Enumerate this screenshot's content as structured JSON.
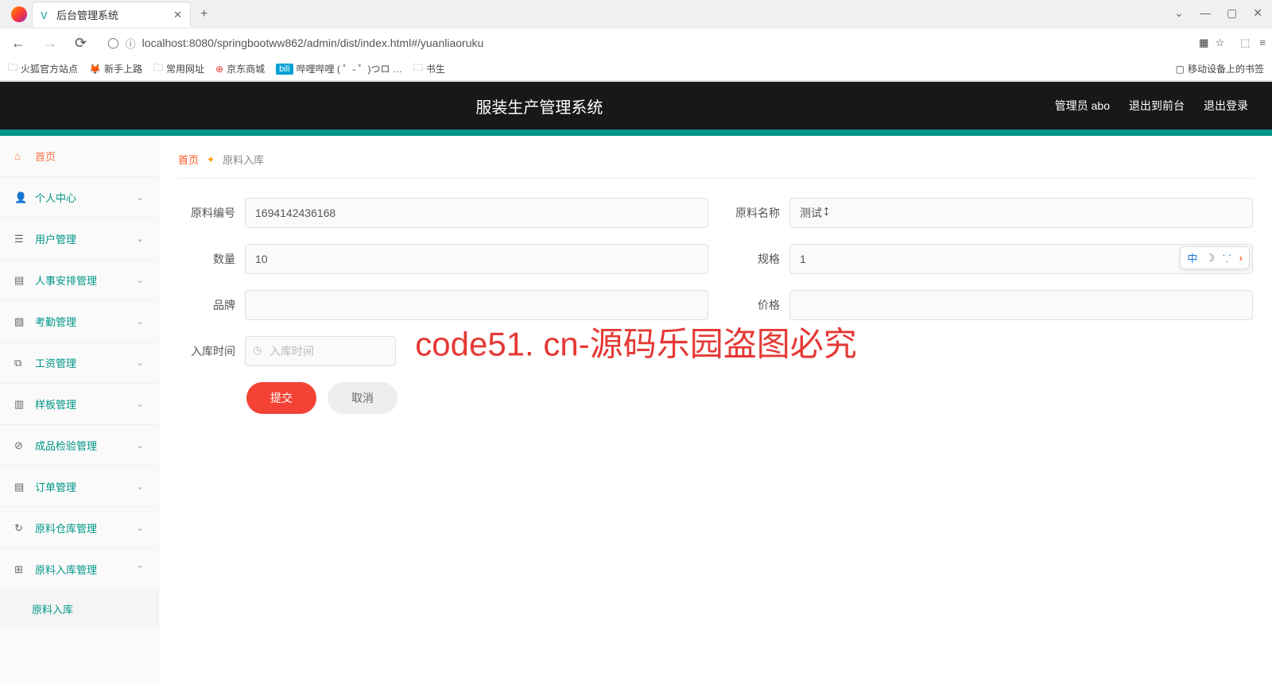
{
  "browser": {
    "tab_title": "后台管理系统",
    "url": "localhost:8080/springbootww862/admin/dist/index.html#/yuanliaoruku",
    "bookmarks": {
      "firefox_official": "火狐官方站点",
      "newbie": "新手上路",
      "common": "常用网址",
      "jd": "京东商城",
      "bilibili": "哔哩哔哩 (  ゜- ゜)つロ …",
      "shusheng": "书生",
      "mobile": "移动设备上的书签"
    }
  },
  "header": {
    "title": "服装生产管理系统",
    "admin": "管理员 abo",
    "exit_front": "退出到前台",
    "logout": "退出登录"
  },
  "sidebar": {
    "home": "首页",
    "personal": "个人中心",
    "user_mgmt": "用户管理",
    "hr_mgmt": "人事安排管理",
    "attendance": "考勤管理",
    "salary": "工资管理",
    "template": "样板管理",
    "product_check": "成品检验管理",
    "order": "订单管理",
    "material_warehouse": "原料仓库管理",
    "material_in": "原料入库管理",
    "submenu_material_in": "原料入库"
  },
  "breadcrumb": {
    "home": "首页",
    "current": "原料入库"
  },
  "form": {
    "material_id_label": "原料编号",
    "material_id_value": "1694142436168",
    "material_name_label": "原料名称",
    "material_name_value": "测试",
    "qty_label": "数量",
    "qty_value": "10",
    "spec_label": "规格",
    "spec_value": "1",
    "brand_label": "品牌",
    "brand_value": "",
    "price_label": "价格",
    "price_value": "",
    "intime_label": "入库时间",
    "intime_placeholder": "入库时间",
    "submit": "提交",
    "cancel": "取消"
  },
  "ime": {
    "zhong": "中"
  },
  "watermark": "code51. cn-源码乐园盗图必究"
}
